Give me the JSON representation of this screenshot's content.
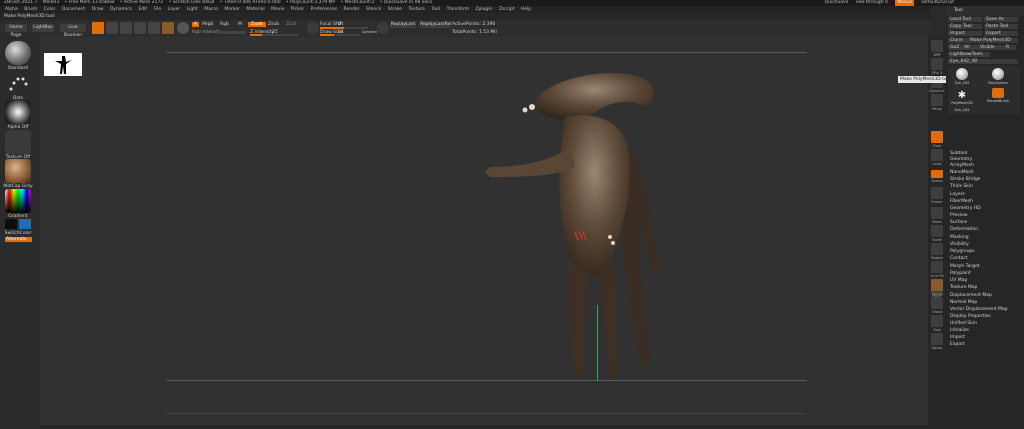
{
  "titlebar": {
    "app": "ZBrush 2021.7",
    "doc": "Mole03",
    "free_mem": "• Free Mem 13.658GB",
    "active_mem": "• Active Mem 2172",
    "scratch": "• Scratch Disk 84Gb",
    "timer": "• Timer:0.006 ATime:0.000",
    "polycount": "• PolyCount:3.379 MP",
    "meshcount": "• MeshCount:2",
    "quicksave": "• QuickSave In 08 Secs",
    "right": {
      "quicksave": "QuickSave",
      "see_through": "See-through 0",
      "menus": "Menus",
      "default_script": "DefaultZScript"
    }
  },
  "menu": [
    "Alpha",
    "Brush",
    "Color",
    "Document",
    "Draw",
    "Dynamics",
    "Edit",
    "File",
    "Layer",
    "Light",
    "Macro",
    "Marker",
    "Material",
    "Movie",
    "Picker",
    "Preferences",
    "Render",
    "Stencil",
    "Stroke",
    "Texture",
    "Tool",
    "Transform",
    "Zplugin",
    "Zscript",
    "Help"
  ],
  "status_text": "Make PolyMesh3D tool",
  "toolbar": {
    "home": "Home Page",
    "lightbox": "LightBox",
    "live_boolean": "Live Boolean",
    "edit": "Edit",
    "draw": "Draw",
    "move": "Move",
    "scale": "Scale",
    "rotate": "Rotate",
    "a_label": "A",
    "mrgb": "Mrgb",
    "rgb": "Rgb",
    "m": "M",
    "zadd": "Zadd",
    "zsub": "Zsub",
    "zcut": "Zcut",
    "rgb_intensity": "Rgb Intensity",
    "z_intensity": "Z Intensity",
    "z_intensity_val": "25",
    "focal_shift": "Focal Shift",
    "focal_shift_val": "0",
    "draw_size": "Draw Size",
    "draw_size_val": "64",
    "dynamic": "Dynamic",
    "replay_last": "ReplayLast",
    "replay_last_rel": "ReplayLastRel",
    "active_points": "ActivePoints: 2.396",
    "total_points": "TotalPoints: 1.53 Mil"
  },
  "left_shelf": {
    "standard": "Standard",
    "dots": "Dots",
    "alpha": "Alpha Off",
    "texture": "Texture Off",
    "matcap": "MatCap Gray",
    "gradient": "Gradient",
    "switch_color": "SwitchColor",
    "alternate": "Alternate"
  },
  "right_shelf": [
    "BPR",
    "SPix 3",
    "Dynamic",
    "Persp",
    "Floor",
    "Local",
    "Gizmo",
    "Frame",
    "Move",
    "Scale",
    "Rotate",
    "Line Fill",
    "PolyF",
    "Transp",
    "Ghost",
    "Solo",
    "Xpose"
  ],
  "tooltip": "Make PolyMesh3D tool",
  "tool_panel": {
    "title": "Tool",
    "buttons": [
      "Load Tool",
      "Save As",
      "Copy Tool",
      "Paste Tool",
      "Import",
      "Export",
      "Clone",
      "Make PolyMesh3D",
      "GoZ",
      "All",
      "Visible",
      "R"
    ],
    "lightbox_tools": "Lightbox▸Tools",
    "tool_name": "Eye_042_48",
    "subtools": [
      "Eye_042",
      "PolySphere",
      "SimpleBrush",
      "Eye_042",
      "PolyMesh3D",
      "Eye_042"
    ],
    "items": [
      "Subtool",
      "Geometry",
      "ArrayMesh",
      "NanoMesh",
      "Stroke Bridge",
      "Thick Skin",
      "Layers",
      "FiberMesh",
      "Geometry HD",
      "Preview",
      "Surface",
      "Deformation",
      "Masking",
      "Visibility",
      "Polygroups",
      "Contact",
      "Morph Target",
      "Polypaint",
      "UV Map",
      "Texture Map",
      "Displacement Map",
      "Normal Map",
      "Vector Displacement Map",
      "Display Properties",
      "Unified Skin",
      "Initialize",
      "Import",
      "Export"
    ]
  },
  "colors": {
    "accent": "#e36c0a",
    "bg": "#2a2a2a",
    "canvas": "#313131"
  }
}
